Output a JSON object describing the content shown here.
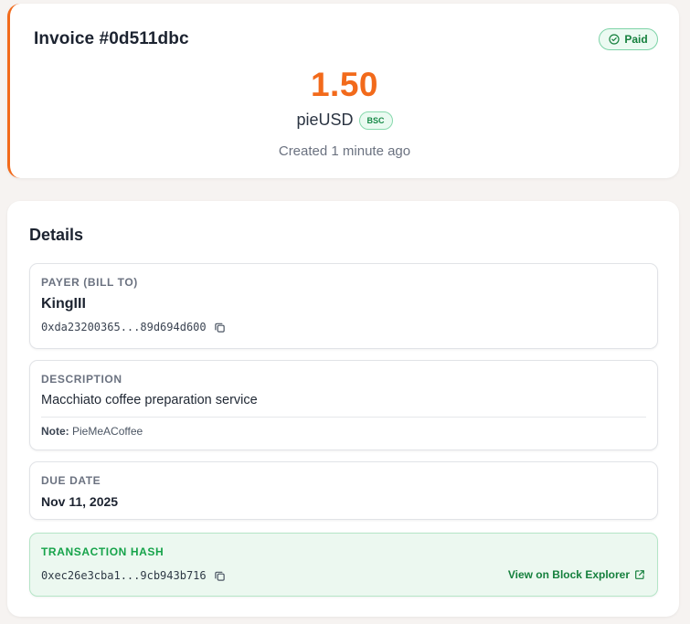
{
  "invoice": {
    "title": "Invoice #0d511dbc",
    "status": "Paid",
    "amount": "1.50",
    "currency": "pieUSD",
    "chain": "BSC",
    "created": "Created 1 minute ago"
  },
  "details": {
    "title": "Details",
    "payer": {
      "label": "PAYER (BILL TO)",
      "name": "KingIII",
      "address": "0xda23200365...89d694d600"
    },
    "description": {
      "label": "DESCRIPTION",
      "text": "Macchiato coffee preparation service",
      "note_label": "Note:",
      "note_text": "PieMeACoffee"
    },
    "due_date": {
      "label": "DUE DATE",
      "value": "Nov 11, 2025"
    },
    "transaction": {
      "label": "TRANSACTION HASH",
      "hash": "0xec26e3cba1...9cb943b716",
      "explorer_link": "View on Block Explorer"
    }
  },
  "colors": {
    "accent": "#f26a1b",
    "success": "#15803d",
    "success_bg": "#ecf8f0"
  }
}
